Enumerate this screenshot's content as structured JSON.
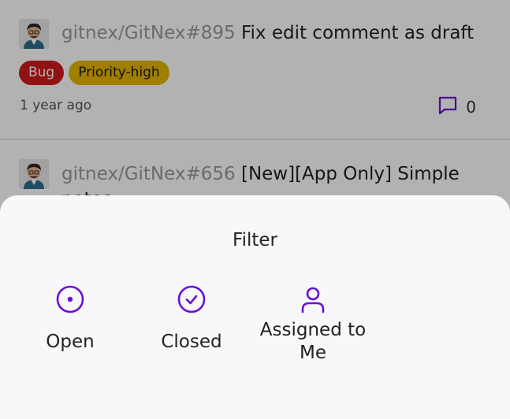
{
  "issues": [
    {
      "repo": "gitnex/GitNex#895",
      "title": "Fix edit comment as draft",
      "labels": [
        "Bug",
        "Priority-high"
      ],
      "time": "1 year ago",
      "comments": "0"
    },
    {
      "repo": "gitnex/GitNex#656",
      "title": "[New][App Only] Simple notes"
    }
  ],
  "filter_sheet": {
    "title": "Filter",
    "options": [
      {
        "label": "Open",
        "icon": "open-circle-icon"
      },
      {
        "label": "Closed",
        "icon": "closed-check-icon"
      },
      {
        "label": "Assigned to Me",
        "icon": "user-icon"
      }
    ]
  },
  "colors": {
    "accent": "#6a0fd6",
    "bug_label": "#d01a1a",
    "priority_label": "#e4b500"
  }
}
